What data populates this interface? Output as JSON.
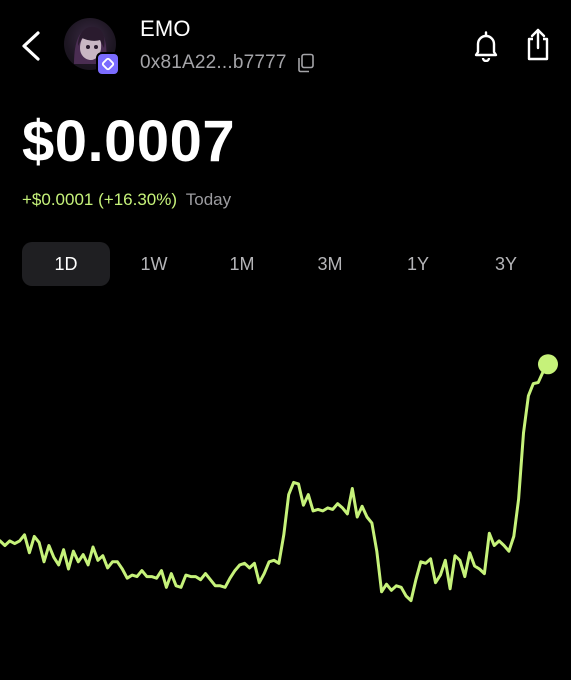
{
  "header": {
    "token_name": "EMO",
    "address": "0x81A22...b7777",
    "icons": [
      "back-arrow-icon",
      "avatar",
      "chain-badge-icon",
      "copy-icon",
      "bell-icon",
      "share-icon"
    ]
  },
  "price": {
    "value": "$0.0007",
    "change": "+$0.0001 (+16.30%)",
    "period": "Today"
  },
  "tabs": [
    {
      "label": "1D",
      "active": true
    },
    {
      "label": "1W",
      "active": false
    },
    {
      "label": "1M",
      "active": false
    },
    {
      "label": "3M",
      "active": false
    },
    {
      "label": "1Y",
      "active": false
    },
    {
      "label": "3Y",
      "active": false
    }
  ],
  "colors": {
    "background": "#000000",
    "accent": "#c6f27a",
    "muted": "#a4a4a8",
    "tab_active": "#1f1f22"
  },
  "chart_data": {
    "type": "line",
    "title": "",
    "xlabel": "",
    "ylabel": "",
    "ylim": [
      0,
      1
    ],
    "series": [
      {
        "values": [
          0.366,
          0.354,
          0.366,
          0.359,
          0.366,
          0.382,
          0.335,
          0.378,
          0.362,
          0.311,
          0.354,
          0.323,
          0.303,
          0.343,
          0.292,
          0.339,
          0.311,
          0.33,
          0.303,
          0.35,
          0.315,
          0.327,
          0.295,
          0.311,
          0.311,
          0.292,
          0.268,
          0.276,
          0.272,
          0.288,
          0.272,
          0.272,
          0.268,
          0.288,
          0.244,
          0.28,
          0.248,
          0.244,
          0.276,
          0.272,
          0.272,
          0.264,
          0.28,
          0.264,
          0.248,
          0.248,
          0.244,
          0.268,
          0.288,
          0.303,
          0.307,
          0.295,
          0.307,
          0.256,
          0.28,
          0.311,
          0.315,
          0.307,
          0.382,
          0.488,
          0.52,
          0.516,
          0.46,
          0.488,
          0.445,
          0.449,
          0.445,
          0.453,
          0.449,
          0.464,
          0.453,
          0.437,
          0.504,
          0.429,
          0.457,
          0.429,
          0.413,
          0.339,
          0.232,
          0.252,
          0.236,
          0.248,
          0.244,
          0.221,
          0.209,
          0.264,
          0.311,
          0.307,
          0.319,
          0.256,
          0.276,
          0.315,
          0.24,
          0.327,
          0.315,
          0.272,
          0.335,
          0.3,
          0.292,
          0.28,
          0.386,
          0.354,
          0.366,
          0.354,
          0.339,
          0.378,
          0.476,
          0.65,
          0.748,
          0.78,
          0.783,
          0.811,
          0.831
        ]
      }
    ],
    "end_marker": true
  }
}
